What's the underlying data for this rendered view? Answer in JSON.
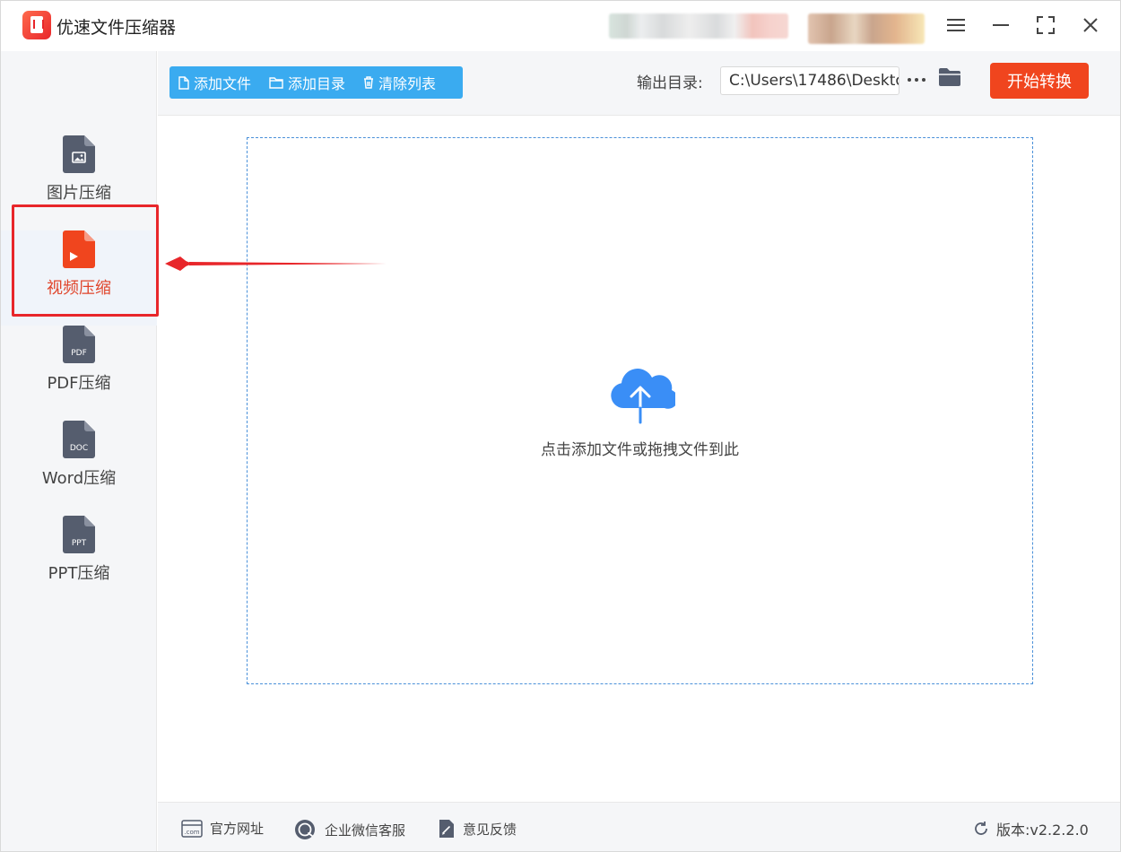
{
  "app": {
    "title": "优速文件压缩器",
    "icon": "app-logo-icon"
  },
  "titlebar": {
    "buttons": [
      "menu-icon",
      "minimize-icon",
      "maximize-icon",
      "close-icon"
    ]
  },
  "sidebar": {
    "items": [
      {
        "label": "图片压缩",
        "icon": "image-file-icon",
        "active": false
      },
      {
        "label": "视频压缩",
        "icon": "video-file-icon",
        "active": true
      },
      {
        "label": "PDF压缩",
        "icon": "pdf-file-icon",
        "active": false,
        "badge": "PDF"
      },
      {
        "label": "Word压缩",
        "icon": "doc-file-icon",
        "active": false,
        "badge": "DOC"
      },
      {
        "label": "PPT压缩",
        "icon": "ppt-file-icon",
        "active": false,
        "badge": "PPT"
      }
    ]
  },
  "toolbar": {
    "add_file": "添加文件",
    "add_folder": "添加目录",
    "clear_list": "清除列表",
    "output_label": "输出目录:",
    "output_path": "C:\\Users\\17486\\Deskto",
    "start_button": "开始转换"
  },
  "dropzone": {
    "text": "点击添加文件或拖拽文件到此",
    "icon": "cloud-upload-icon"
  },
  "footer": {
    "website": "官方网址",
    "wechat_support": "企业微信客服",
    "feedback": "意见反馈",
    "version": "版本:v2.2.2.0",
    "website_badge": ".com"
  },
  "colors": {
    "accent_blue": "#3aabf0",
    "start_orange": "#f0451e",
    "active_red": "#e0452b",
    "highlight_red": "#e8262a",
    "icon_slate": "#555d6e"
  }
}
